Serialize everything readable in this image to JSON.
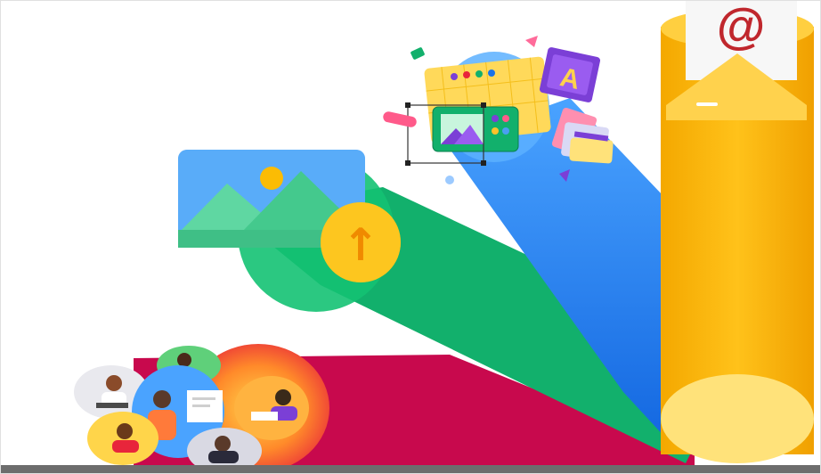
{
  "illustration": {
    "email_symbol": "@",
    "upload_arrow": "↑",
    "palette_letter": "A",
    "icons": [
      "at-sign-icon",
      "upload-arrow-icon",
      "image-icon",
      "design-board-icon",
      "color-swatch-icon",
      "people-avatar-icon"
    ],
    "colors": {
      "red": "#c8094d",
      "green": "#12b06c",
      "blue": "#1a73e8",
      "yellow": "#fbbc04",
      "orange": "#ffc12a",
      "purple": "#7b3fd6"
    }
  }
}
